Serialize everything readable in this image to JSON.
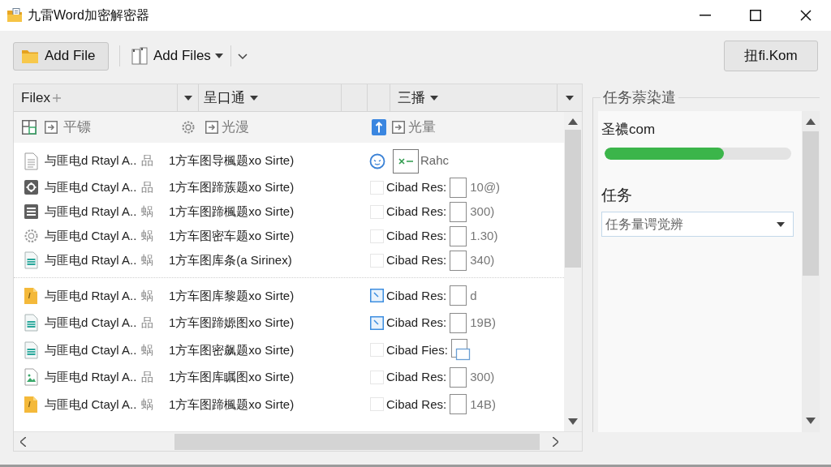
{
  "window": {
    "title": "九雷Word加密解密器"
  },
  "toolbar": {
    "add_file": {
      "label": "Add File"
    },
    "add_files": {
      "label": "Add Files"
    },
    "action_button": {
      "label": "扭fi.Kom"
    }
  },
  "file_list": {
    "columns": [
      {
        "label": "Filex"
      },
      {
        "label": "呈口通"
      },
      {
        "label": "三播"
      }
    ],
    "sub_columns": [
      {
        "label": "平镖"
      },
      {
        "label": "光漫"
      },
      {
        "label": "光量"
      }
    ],
    "groups": [
      {
        "rows": [
          {
            "name": "与匪电d Rtayl A..",
            "suffix": "品",
            "path": "1方车图导楓题xo Sirte)",
            "kind": "preview",
            "status": "Rahc"
          },
          {
            "name": "与匪电d Ctayl A..",
            "suffix": "品",
            "path": "1方车图蹄蔟题xo Sirte)",
            "kind": "status",
            "checked": false,
            "status": "Cibad Res:",
            "value": "10@)"
          },
          {
            "name": "与匪电d Rtayl A..",
            "suffix": "蜗",
            "path": "1方车图蹄楓题xo Sirte)",
            "kind": "status",
            "checked": false,
            "status": "Cibad Res:",
            "value": "300)"
          },
          {
            "name": "与匪电d Ctayl A..",
            "suffix": "蜗",
            "path": "1方车图密车题xo Sirte)",
            "kind": "status",
            "checked": false,
            "status": "Cibad Res:",
            "value": "1.30)"
          },
          {
            "name": "与匪电d Rtayl A..",
            "suffix": "蜗",
            "path": "1方车图库条(a Sirinex)",
            "kind": "status",
            "checked": false,
            "status": "Cibad Res:",
            "value": "340)"
          }
        ]
      },
      {
        "rows": [
          {
            "name": "与匪电d Rtayl A..",
            "suffix": "蜗",
            "path": "1方车图库黎题xo Sirte)",
            "kind": "status",
            "checked": true,
            "status": "Cibad Res:",
            "value": "d"
          },
          {
            "name": "与匪电d Ctayl A..",
            "suffix": "品",
            "path": "1方车图蹄嫄图xo Sirte)",
            "kind": "status",
            "checked": true,
            "status": "Cibad Res:",
            "value": "19B)"
          },
          {
            "name": "与匪电d Ctayl A..",
            "suffix": "蜗",
            "path": "1方车图密飙题xo Sirte)",
            "kind": "stacked",
            "checked": false,
            "status": "Cibad Fies:"
          },
          {
            "name": "与匪电d Rtayl A..",
            "suffix": "品",
            "path": "1方车图库瞩图xo Sirte)",
            "kind": "status",
            "checked": false,
            "status": "Cibad Res:",
            "value": "300)"
          },
          {
            "name": "与匪电d Ctayl A..",
            "suffix": "蜗",
            "path": "1方车图蹄楓题xo Sirte)",
            "kind": "status",
            "checked": false,
            "status": "Cibad Res:",
            "value": "14B)"
          }
        ]
      }
    ]
  },
  "task_panel": {
    "title": "任务萘染遣",
    "progress": {
      "label": "圣禯com",
      "level": 0.64
    },
    "task": {
      "label": "任务",
      "value": "任务量谔觉辨"
    }
  }
}
